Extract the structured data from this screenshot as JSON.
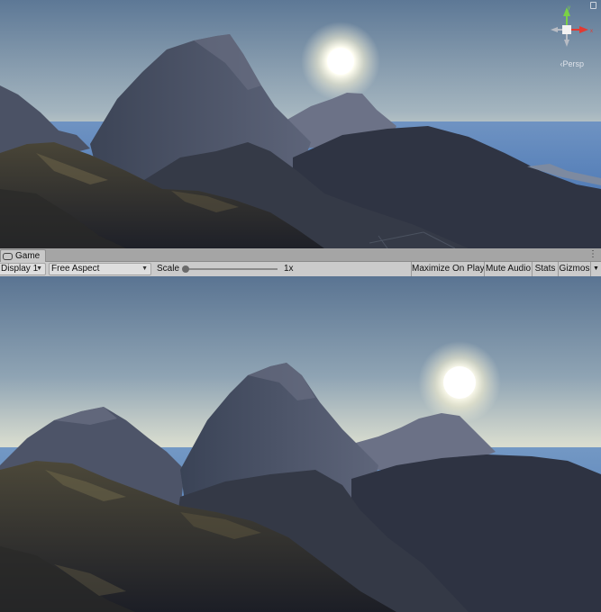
{
  "scene": {
    "projection_label": "‹Persp",
    "gizmo_axes": {
      "x": "x",
      "y": "y"
    }
  },
  "tab": {
    "label": "Game",
    "menu_glyph": "⋮",
    "icon": "gamepad-icon"
  },
  "toolbar": {
    "display": "Display 1",
    "aspect": "Free Aspect",
    "scale_label": "Scale",
    "scale_value": "1x",
    "scale_level": 0.0,
    "maximize": "Maximize On Play",
    "mute": "Mute Audio",
    "stats": "Stats",
    "gizmos": "Gizmos"
  },
  "colors": {
    "toolbar_bg": "#cbcbcb",
    "tab_bg": "#a5a5a5",
    "sky_top": "#5a7593",
    "sky_horizon": "#dcdfd3",
    "sea": "#4a79b8"
  }
}
